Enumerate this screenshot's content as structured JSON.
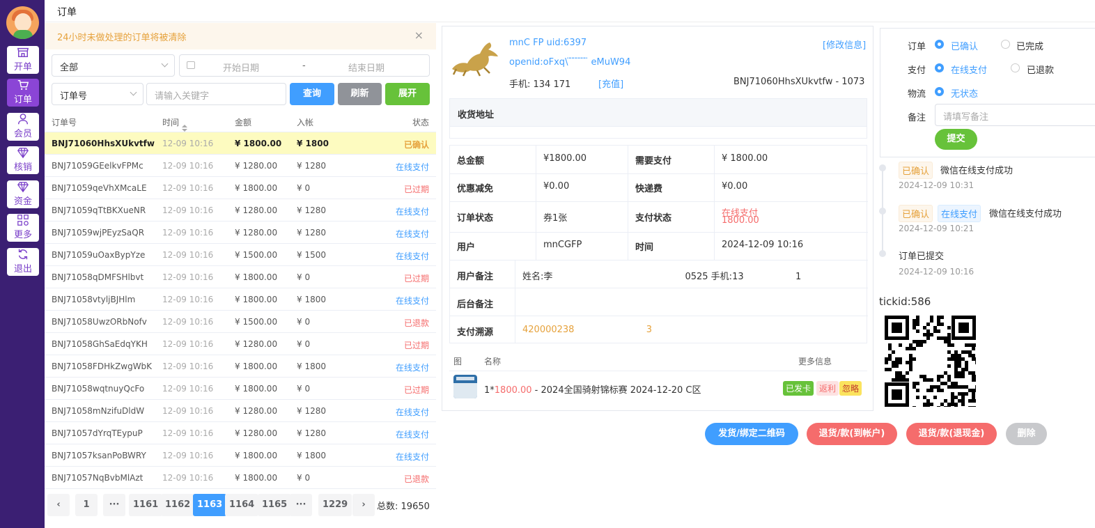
{
  "sidebar": {
    "items": [
      {
        "label": "开单",
        "icon": "shop-icon"
      },
      {
        "label": "订单",
        "icon": "cart-icon"
      },
      {
        "label": "会员",
        "icon": "user-icon"
      },
      {
        "label": "核销",
        "icon": "diamond-icon"
      },
      {
        "label": "资金",
        "icon": "diamond-icon"
      },
      {
        "label": "更多",
        "icon": "grid-icon"
      },
      {
        "label": "退出",
        "icon": "refresh-icon"
      }
    ]
  },
  "topbar": {
    "title": "订单"
  },
  "notice": {
    "text": "24小时未做处理的订单将被清除",
    "close": "×"
  },
  "filters": {
    "status_select": "全部",
    "date_start": "开始日期",
    "date_sep": "-",
    "date_end": "结束日期",
    "field_select": "订单号",
    "keyword_placeholder": "请输入关键字",
    "query": "查询",
    "refresh": "刷新",
    "expand": "展开"
  },
  "table": {
    "headers": {
      "id": "订单号",
      "time": "时间",
      "amount": "金额",
      "income": "入帐",
      "status": "状态"
    },
    "rows": [
      {
        "id": "BNJ71060HhsXUkvtfw",
        "time": "12-09 10:16",
        "amount": "¥ 1800.00",
        "income": "¥ 1800",
        "status": "已确认"
      },
      {
        "id": "BNJ71059GEelkvFPMc",
        "time": "12-09 10:16",
        "amount": "¥ 1280.00",
        "income": "¥ 1280",
        "status": "在线支付"
      },
      {
        "id": "BNJ71059qeVhXMcaLE",
        "time": "12-09 10:16",
        "amount": "¥ 1800.00",
        "income": "¥ 0",
        "status": "已过期"
      },
      {
        "id": "BNJ71059qTtBKXueNR",
        "time": "12-09 10:16",
        "amount": "¥ 1280.00",
        "income": "¥ 1280",
        "status": "在线支付"
      },
      {
        "id": "BNJ71059wjPEyzSaQR",
        "time": "12-09 10:16",
        "amount": "¥ 1280.00",
        "income": "¥ 1280",
        "status": "在线支付"
      },
      {
        "id": "BNJ71059uOaxBypYze",
        "time": "12-09 10:16",
        "amount": "¥ 1500.00",
        "income": "¥ 1500",
        "status": "在线支付"
      },
      {
        "id": "BNJ71058qDMFSHlbvt",
        "time": "12-09 10:16",
        "amount": "¥ 1800.00",
        "income": "¥ 0",
        "status": "已过期"
      },
      {
        "id": "BNJ71058vtyljBJHlm",
        "time": "12-09 10:16",
        "amount": "¥ 1800.00",
        "income": "¥ 1800",
        "status": "在线支付"
      },
      {
        "id": "BNJ71058UwzORbNofv",
        "time": "12-09 10:16",
        "amount": "¥ 1500.00",
        "income": "¥ 0",
        "status": "已退款"
      },
      {
        "id": "BNJ71058GhSaEdqYKH",
        "time": "12-09 10:16",
        "amount": "¥ 1280.00",
        "income": "¥ 0",
        "status": "已过期"
      },
      {
        "id": "BNJ71058FDHkZwgWbK",
        "time": "12-09 10:16",
        "amount": "¥ 1800.00",
        "income": "¥ 1800",
        "status": "在线支付"
      },
      {
        "id": "BNJ71058wqtnuyQcFo",
        "time": "12-09 10:16",
        "amount": "¥ 1800.00",
        "income": "¥ 0",
        "status": "已过期"
      },
      {
        "id": "BNJ71058mNzifuDldW",
        "time": "12-09 10:16",
        "amount": "¥ 1280.00",
        "income": "¥ 1280",
        "status": "在线支付"
      },
      {
        "id": "BNJ71057dYrqTEypuP",
        "time": "12-09 10:16",
        "amount": "¥ 1280.00",
        "income": "¥ 1280",
        "status": "在线支付"
      },
      {
        "id": "BNJ71057ksanPoBWRY",
        "time": "12-09 10:16",
        "amount": "¥ 1800.00",
        "income": "¥ 1800",
        "status": "在线支付"
      },
      {
        "id": "BNJ71057NqBvbMlAzt",
        "time": "12-09 10:16",
        "amount": "¥ 1800.00",
        "income": "¥ 0",
        "status": "已退款"
      }
    ]
  },
  "pager": {
    "prev": "‹",
    "first": "1",
    "ellipsis": "···",
    "pages": [
      "1161",
      "1162",
      "1163",
      "1164",
      "1165"
    ],
    "last": "1229",
    "next": "›",
    "total_label": "总数:",
    "total": "19650"
  },
  "detail": {
    "user_line": "mnC   FP uid:6397",
    "edit": "[修改信息]",
    "openid": "openid:oFxq\\   ̈ ̈   ̈   ̈ ̈   ̈ ̈  eMuW94",
    "phone": "手机: 134           171",
    "recharge": "[充值]",
    "order_ref": "BNJ71060HhsXUkvtfw - 1073",
    "address_label": "收货地址",
    "total_label": "总金额",
    "total": "¥1800.00",
    "need_pay_label": "需要支付",
    "need_pay": "¥ 1800.00",
    "discount_label": "优惠减免",
    "discount": "¥0.00",
    "shipping_label": "快递费",
    "shipping": "¥0.00",
    "order_status_label": "订单状态",
    "order_status": "券1张",
    "pay_status_label": "支付状态",
    "pay_status": "在线支付",
    "pay_amount": "1800.00",
    "user_label": "用户",
    "user": "mnCGFP",
    "time_label": "时间",
    "time": "2024-12-09 10:16",
    "user_note_label": "用户备注",
    "user_note": "姓名:李                                              0525 手机:13                  1",
    "admin_note_label": "后台备注",
    "pay_source_label": "支付溯源",
    "pay_source": "420000238‌‌‌                         3",
    "item_col_img": "图",
    "item_col_name": "名称",
    "item_col_more": "更多信息",
    "item_qty": "1*",
    "item_price": "1800.00",
    "item_name": " - 2024全国骑射锦标赛 2024-12-20 C区",
    "tag_shipped": "已发卡",
    "tag_rebate": "返利",
    "tag_ignore": "忽略"
  },
  "status_form": {
    "order_label": "订单",
    "order_opt1": "已确认",
    "order_opt2": "已完成",
    "pay_label": "支付",
    "pay_opt1": "在线支付",
    "pay_opt2": "已退款",
    "logistics_label": "物流",
    "logistics_opt1": "无状态",
    "note_label": "备注",
    "note_placeholder": "请填写备注",
    "submit": "提交"
  },
  "timeline": [
    {
      "tag1": "已确认",
      "text": "微信在线支付成功",
      "time": "2024-12-09 10:31"
    },
    {
      "tag1": "已确认",
      "tag2": "在线支付",
      "text": "微信在线支付成功",
      "time": "2024-12-09 10:21"
    },
    {
      "text": "订单已提交",
      "time": "2024-12-09 10:16"
    }
  ],
  "tickid": "tickid:586",
  "actions": {
    "ship": "发货/绑定二维码",
    "refund_account": "退货/款(到帐户)",
    "refund_cash": "退货/款(退现金)",
    "delete": "删除"
  },
  "colors": {
    "primary": "#409eff",
    "danger": "#f56c6c",
    "success": "#67c23a",
    "warning": "#e6a23c",
    "sidebar": "#3b1f73",
    "accent": "#8b45d6"
  }
}
